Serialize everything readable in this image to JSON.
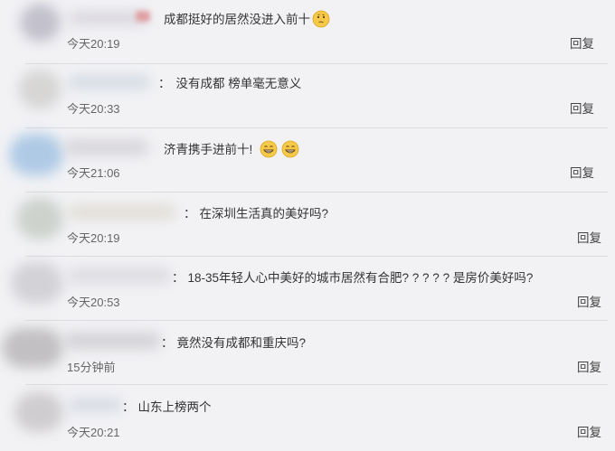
{
  "comments": [
    {
      "text": "成都挺好的居然没进入前十",
      "time": "今天20:19",
      "reply": "回复",
      "emoji": [
        "thinking-emoji"
      ]
    },
    {
      "text": "没有成都 榜单毫无意义",
      "time": "今天20:33",
      "reply": "回复",
      "emoji": []
    },
    {
      "text": "济青携手进前十!",
      "time": "今天21:06",
      "reply": "回复",
      "emoji": [
        "grin-emoji",
        "grin-emoji"
      ]
    },
    {
      "text": "在深圳生活真的美好吗?",
      "time": "今天20:19",
      "reply": "回复",
      "emoji": []
    },
    {
      "text": "18-35年轻人心中美好的城市居然有合肥? ? ? ? ? 是房价美好吗?",
      "time": "今天20:53",
      "reply": "回复",
      "emoji": []
    },
    {
      "text": "竟然没有成都和重庆吗?",
      "time": "15分钟前",
      "reply": "回复",
      "emoji": []
    },
    {
      "text": "山东上榜两个",
      "time": "今天20:21",
      "reply": "回复",
      "emoji": []
    }
  ],
  "colors": {
    "background": "#f2f2f5",
    "emoji_face": "#f7c948",
    "blur_tint": "#c9c9d6"
  }
}
